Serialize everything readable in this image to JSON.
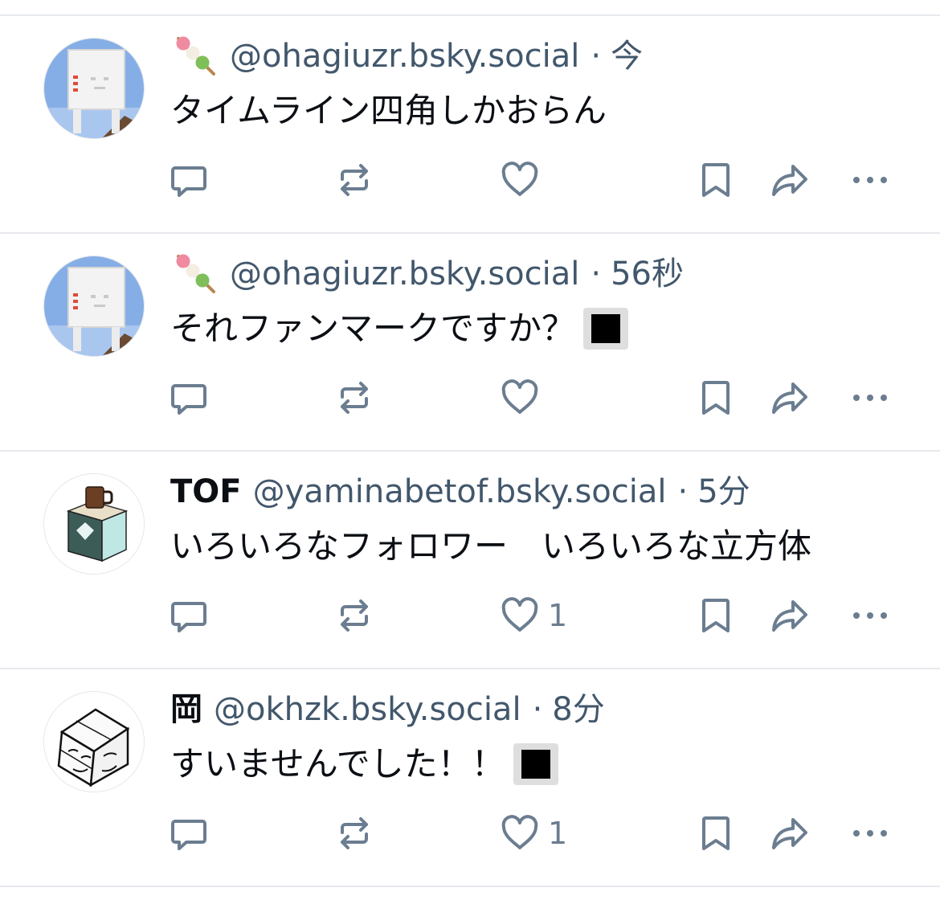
{
  "colors": {
    "icon": "#6b7d90",
    "meta": "#42576c",
    "divider": "#e6e9ee"
  },
  "posts": [
    {
      "avatar_icon": "blocky-ghost-avatar",
      "emoji_icon": "dango-emoji",
      "display_name": "",
      "handle": "@ohagiuzr.bsky.social",
      "separator": "·",
      "time": "今",
      "text": "タイムライン四角しかおらん",
      "has_square_emoji": false,
      "like_count": ""
    },
    {
      "avatar_icon": "blocky-ghost-avatar",
      "emoji_icon": "dango-emoji",
      "display_name": "",
      "handle": "@ohagiuzr.bsky.social",
      "separator": "·",
      "time": "56秒",
      "text": "それファンマークですか？",
      "has_square_emoji": true,
      "like_count": ""
    },
    {
      "avatar_icon": "mug-cube-avatar",
      "emoji_icon": "",
      "display_name": "TOF",
      "handle": "@yaminabetof.bsky.social",
      "separator": "·",
      "time": "5分",
      "text": "いろいろなフォロワー　いろいろな立方体",
      "has_square_emoji": false,
      "like_count": "1"
    },
    {
      "avatar_icon": "sketch-cube-avatar",
      "emoji_icon": "",
      "display_name": "岡",
      "handle": "@okhzk.bsky.social",
      "separator": "·",
      "time": "8分",
      "text": "すいませんでした！！",
      "has_square_emoji": true,
      "like_count": "1"
    }
  ],
  "action_icons": [
    "reply-icon",
    "repost-icon",
    "like-icon",
    "bookmark-icon",
    "share-icon",
    "more-icon"
  ]
}
